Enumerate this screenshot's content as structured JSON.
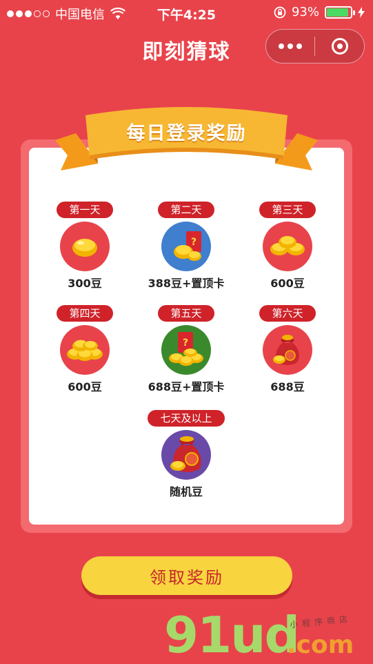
{
  "status_bar": {
    "carrier": "中国电信",
    "time": "下午4:25",
    "battery": "93%",
    "battery_level": 0.93
  },
  "nav": {
    "title": "即刻猜球"
  },
  "ribbon": {
    "title": "每日登录奖励"
  },
  "rewards": [
    {
      "day": "第一天",
      "label": "300豆",
      "icon": "single-bean-icon"
    },
    {
      "day": "第二天",
      "label": "388豆+置顶卡",
      "icon": "bean-mystery-card-icon"
    },
    {
      "day": "第三天",
      "label": "600豆",
      "icon": "bean-pile-icon"
    },
    {
      "day": "第四天",
      "label": "600豆",
      "icon": "bean-pile-icon"
    },
    {
      "day": "第五天",
      "label": "688豆+置顶卡",
      "icon": "bean-mystery-card-icon"
    },
    {
      "day": "第六天",
      "label": "688豆",
      "icon": "bean-pouch-icon"
    },
    {
      "day": "七天及以上",
      "label": "随机豆",
      "icon": "big-bean-pouch-icon"
    }
  ],
  "claim_button": "领取奖励",
  "watermark": {
    "main": "91ud",
    "suffix": ".com",
    "small": "小程序商店"
  },
  "colors": {
    "background": "#e8434b",
    "tag": "#cf2229",
    "button": "#f8d43e",
    "button_text": "#c5262d",
    "ribbon": "#f7b733",
    "circle_red": "#e8434b",
    "circle_blue": "#3f7fce",
    "circle_green": "#3a8a2d",
    "circle_purple": "#6a4aa8"
  }
}
